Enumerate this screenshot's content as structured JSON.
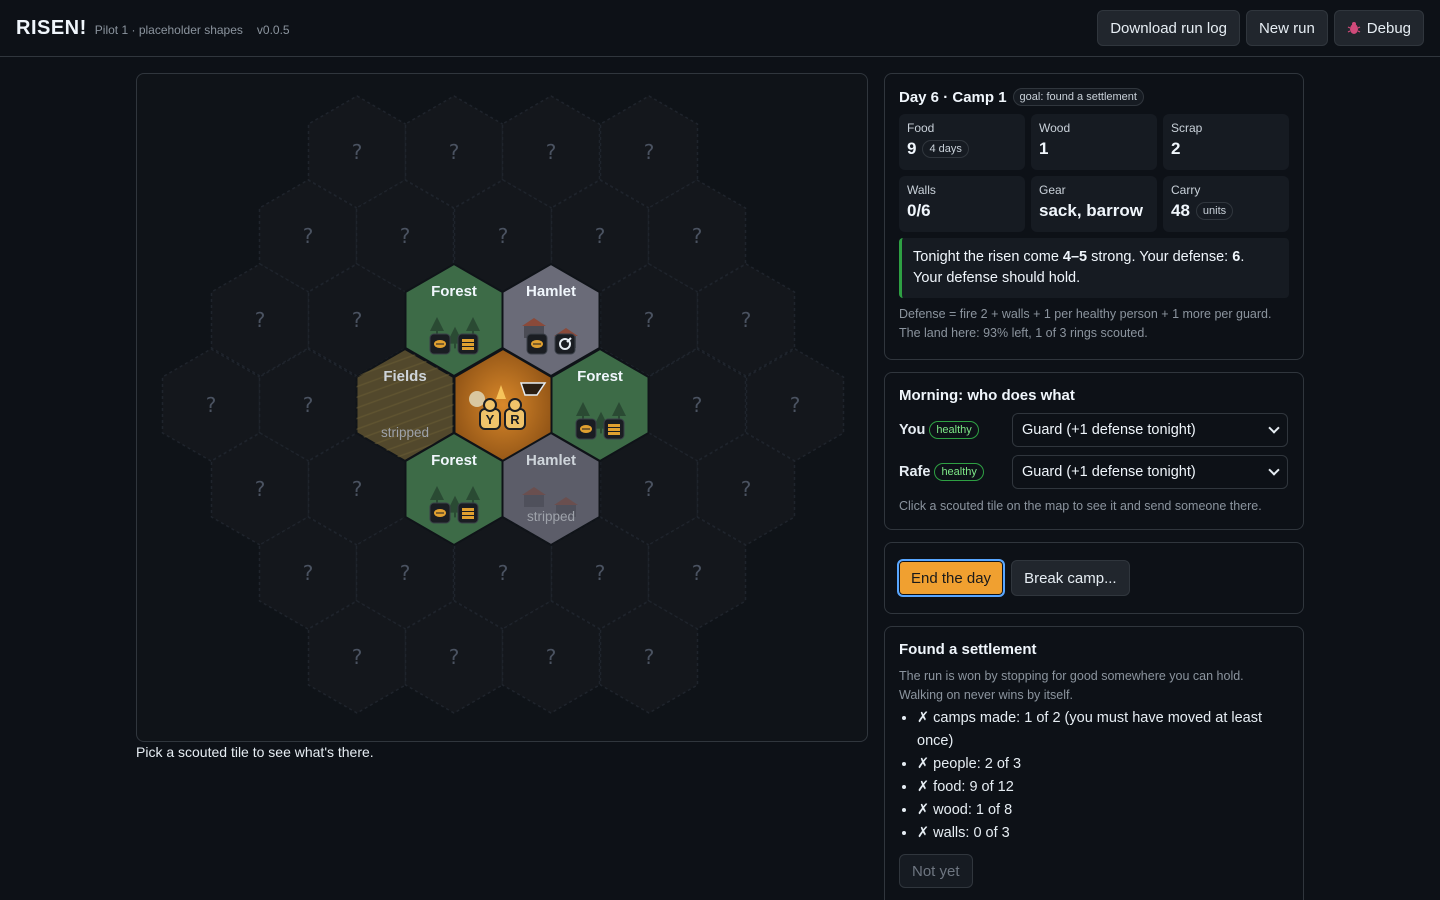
{
  "header": {
    "brand": "RISEN!",
    "subtitle": "Pilot 1 · placeholder shapes",
    "version": "v0.0.5",
    "download_label": "Download run log",
    "new_run_label": "New run",
    "debug_label": "Debug"
  },
  "map": {
    "unknown_glyph": "?",
    "caption": "Pick a scouted tile to see what's there.",
    "tiles": [
      {
        "label": "Forest",
        "type": "forest",
        "status": "",
        "icons": [
          "food-icon",
          "wood-icon"
        ]
      },
      {
        "label": "Hamlet",
        "type": "hamlet",
        "status": "",
        "icons": [
          "food-icon",
          "scrap-icon"
        ]
      },
      {
        "label": "Fields",
        "type": "fields",
        "status": "stripped",
        "icons": []
      },
      {
        "label": "Forest",
        "type": "forest",
        "status": "",
        "icons": [
          "food-icon",
          "wood-icon"
        ]
      },
      {
        "label": "Forest",
        "type": "forest",
        "status": "",
        "icons": [
          "food-icon",
          "wood-icon"
        ]
      },
      {
        "label": "Hamlet",
        "type": "hamlet",
        "status": "stripped",
        "icons": []
      }
    ],
    "camp": {
      "people": [
        "Y",
        "R"
      ]
    }
  },
  "status": {
    "day_title": "Day 6 · Camp 1",
    "goal_pill": "goal: found a settlement",
    "stats": {
      "food": {
        "label": "Food",
        "value": "9",
        "extra": "4 days"
      },
      "wood": {
        "label": "Wood",
        "value": "1"
      },
      "scrap": {
        "label": "Scrap",
        "value": "2"
      },
      "walls": {
        "label": "Walls",
        "value": "0/6"
      },
      "gear": {
        "label": "Gear",
        "value": "sack, barrow"
      },
      "carry": {
        "label": "Carry",
        "value": "48",
        "extra": "units"
      }
    },
    "alert_pre": "Tonight the risen come ",
    "alert_range": "4–5",
    "alert_mid": " strong. Your defense: ",
    "alert_defense": "6",
    "alert_end": ".",
    "alert_line2": "Your defense should hold.",
    "formula": "Defense = fire 2 + walls + 1 per healthy person + 1 more per guard.",
    "land": "The land here: 93% left, 1 of 3 rings scouted."
  },
  "morning": {
    "title": "Morning: who does what",
    "people": [
      {
        "name": "You",
        "state": "healthy",
        "task": "Guard (+1 defense tonight)"
      },
      {
        "name": "Rafe",
        "state": "healthy",
        "task": "Guard (+1 defense tonight)"
      }
    ],
    "hint": "Click a scouted tile on the map to see it and send someone there."
  },
  "actions": {
    "end_day": "End the day",
    "break_camp": "Break camp..."
  },
  "settlement": {
    "title": "Found a settlement",
    "desc1": "The run is won by stopping for good somewhere you can hold.",
    "desc2": "Walking on never wins by itself.",
    "goals": [
      "✗ camps made: 1 of 2 (you must have moved at least once)",
      "✗ people: 2 of 3",
      "✗ food: 9 of 12",
      "✗ wood: 1 of 8",
      "✗ walls: 0 of 3"
    ],
    "button": "Not yet"
  },
  "colors": {
    "forest": "#3d6b47",
    "hamlet": "#6a6b78",
    "fields": "#5e5230",
    "camp": "#b36a1c",
    "unknown": "#14171c",
    "accent": "#f0a030"
  }
}
